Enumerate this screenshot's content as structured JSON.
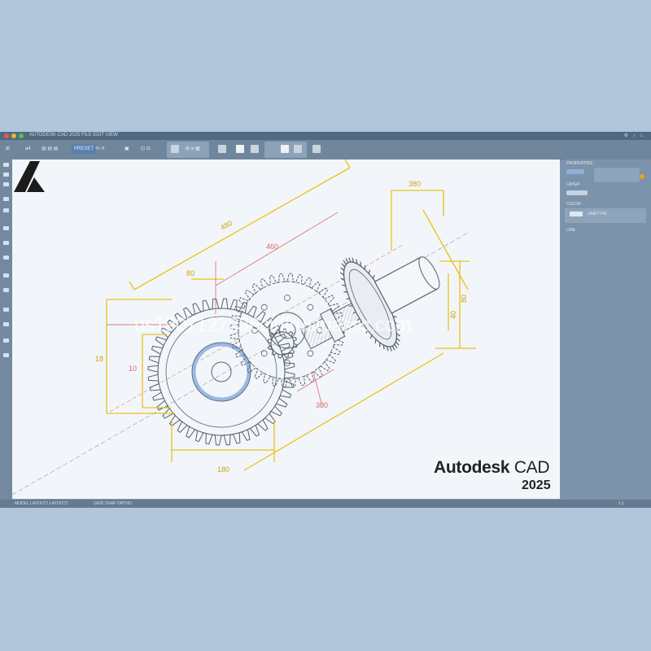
{
  "titlebar": {
    "menu_text": "AUTODESK CAD 2025   FILE   EDIT   VIEW",
    "right_icons": "⚙ ♪ ⌂"
  },
  "toolbar": {
    "items": [
      "⊞",
      "a4",
      "▤ ▤ ▤",
      "PRESET",
      "⟲ ↺",
      "▣",
      "⊡ ⊡"
    ],
    "group_label": "⊞ ⌀ ▦"
  },
  "drawing": {
    "dimensions": {
      "top_right": "380",
      "long_diag": "480",
      "red_diag": "460",
      "short_top": "80",
      "left_vertical": "18",
      "left_inner": "10",
      "bottom": "180",
      "gear_bottom": "380",
      "right_vertical": "40",
      "right_outer": "80"
    },
    "colors": {
      "line": "#55606c",
      "dimension_yellow": "#e8c21a",
      "dimension_red": "#e07a7a",
      "highlight": "#9bb8e6",
      "canvas": "#f2f6fa"
    }
  },
  "logo": {
    "name_bold": "Autodesk",
    "name_light": " CAD",
    "year": "2025"
  },
  "right_panel": {
    "rows": [
      "PROPERTIES",
      "LAYER",
      "COLOR",
      "LINETYPE",
      "LINE"
    ],
    "accent": "#f0a020"
  },
  "statusbar": {
    "left": "MODEL  LAYOUT1  LAYOUT2",
    "mid": "GRID  SNAP  ORTHO",
    "right": "1:1"
  },
  "watermark": "us1907127236ctrlfrustpassc.com"
}
